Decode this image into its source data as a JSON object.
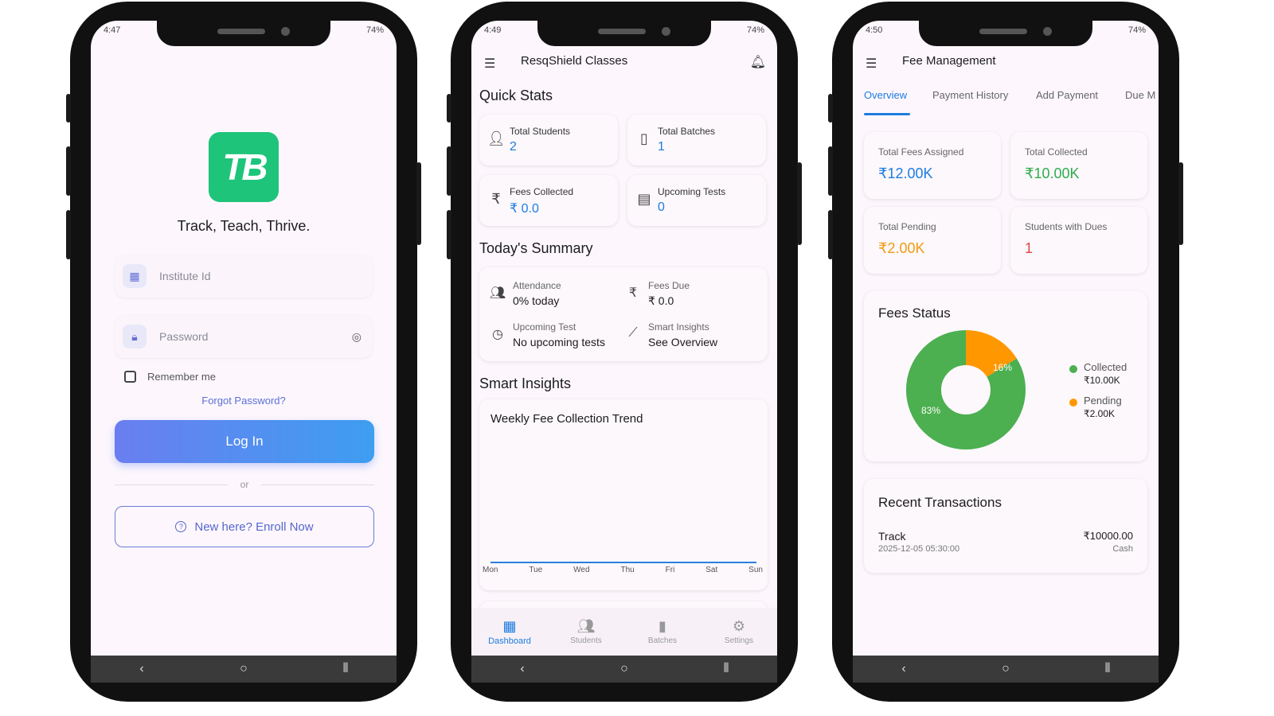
{
  "login": {
    "status_time": "4:47",
    "status_right": "74%",
    "logo_text": "TB",
    "tagline": "Track, Teach, Thrive.",
    "institute_placeholder": "Institute Id",
    "password_placeholder": "Password",
    "remember_label": "Remember me",
    "forgot_label": "Forgot Password?",
    "login_label": "Log In",
    "or_label": "or",
    "enroll_label": "New here? Enroll Now"
  },
  "dashboard": {
    "status_time": "4:49",
    "status_right": "74%",
    "app_title": "ResqShield Classes",
    "quick_stats_title": "Quick Stats",
    "stats": [
      {
        "label": "Total Students",
        "value": "2",
        "icon": "person-icon"
      },
      {
        "label": "Total Batches",
        "value": "1",
        "icon": "book-icon"
      },
      {
        "label": "Fees Collected",
        "value": "₹ 0.0",
        "icon": "rupee-icon"
      },
      {
        "label": "Upcoming Tests",
        "value": "0",
        "icon": "clipboard-icon"
      }
    ],
    "summary_title": "Today's Summary",
    "summary": [
      {
        "label": "Attendance",
        "value": "0% today"
      },
      {
        "label": "Fees Due",
        "value": "₹ 0.0"
      },
      {
        "label": "Upcoming Test",
        "value": "No upcoming tests"
      },
      {
        "label": "Smart Insights",
        "value": "See Overview"
      }
    ],
    "insights_title": "Smart Insights",
    "trend_title": "Weekly Fee Collection Trend",
    "trend_days": [
      "Mon",
      "Tue",
      "Wed",
      "Thu",
      "Fri",
      "Sat",
      "Sun"
    ],
    "nav": [
      {
        "label": "Dashboard",
        "active": true
      },
      {
        "label": "Students",
        "active": false
      },
      {
        "label": "Batches",
        "active": false
      },
      {
        "label": "Settings",
        "active": false
      }
    ]
  },
  "fees": {
    "status_time": "4:50",
    "status_right": "74%",
    "app_title": "Fee Management",
    "tabs": [
      "Overview",
      "Payment History",
      "Add Payment",
      "Due M"
    ],
    "cards": [
      {
        "label": "Total Fees Assigned",
        "value": "₹12.00K",
        "color": "#1e7ce0"
      },
      {
        "label": "Total Collected",
        "value": "₹10.00K",
        "color": "#2fae4a"
      },
      {
        "label": "Total Pending",
        "value": "₹2.00K",
        "color": "#f29b12"
      },
      {
        "label": "Students with Dues",
        "value": "1",
        "color": "#e04848"
      }
    ],
    "status_title": "Fees Status",
    "donut": {
      "collected_pct": 83,
      "pending_pct": 16,
      "collected_label": "83%",
      "pending_label": "16%",
      "collected_color": "#4caf50",
      "pending_color": "#ff9800"
    },
    "legend": [
      {
        "label": "Collected",
        "value": "₹10.00K",
        "color": "#4caf50"
      },
      {
        "label": "Pending",
        "value": "₹2.00K",
        "color": "#ff9800"
      }
    ],
    "recent_title": "Recent Transactions",
    "transaction": {
      "name": "Track",
      "date": "2025-12-05 05:30:00",
      "amount": "₹10000.00",
      "method": "Cash"
    }
  }
}
